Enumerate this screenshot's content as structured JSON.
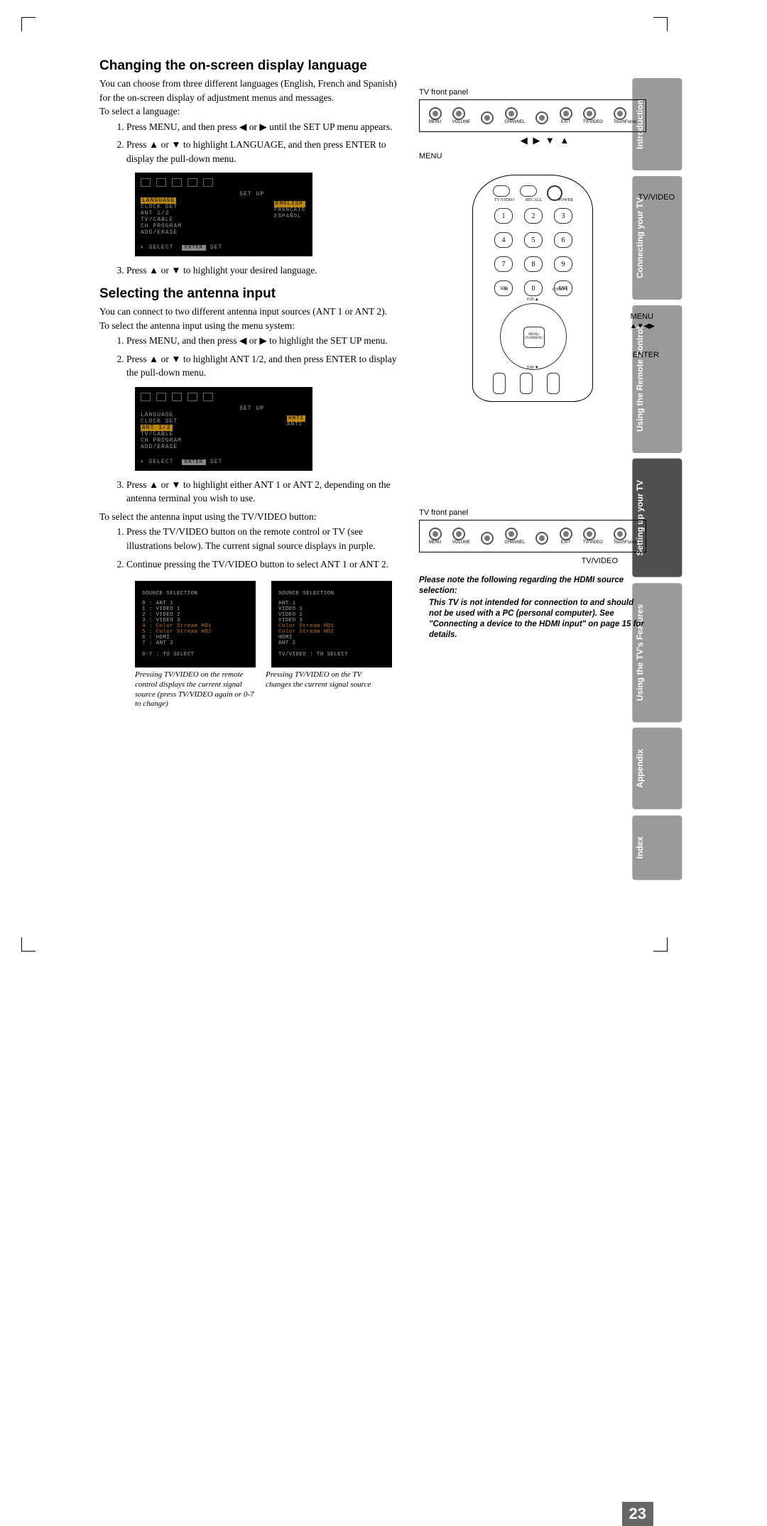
{
  "headings": {
    "h1a": "Changing the on-screen display language",
    "h1b": "Selecting the antenna input"
  },
  "body": {
    "p1": "You can choose from three different languages (English, French and Spanish) for the on-screen display of adjustment menus and messages.",
    "p2": "To select a language:",
    "li1": "Press MENU, and then press ◀ or ▶ until the SET UP menu appears.",
    "li2": "Press ▲ or ▼ to highlight LANGUAGE, and then press ENTER to display the pull-down menu.",
    "li3": "Press ▲ or ▼ to highlight your desired language.",
    "p3": "You can connect to two different antenna input sources (ANT 1 or ANT 2).",
    "p4": "To select the antenna input using the menu system:",
    "li4": "Press MENU, and then press ◀ or ▶ to highlight the SET UP menu.",
    "li5": "Press ▲ or ▼ to highlight ANT 1/2, and then press ENTER to display the pull-down menu.",
    "li6": "Press ▲ or ▼ to highlight either ANT 1 or ANT 2, depending on the antenna terminal you wish to use.",
    "p5": "To select the antenna input using the TV/VIDEO button:",
    "li7": "Press the TV/VIDEO button on the remote control or TV (see illustrations below). The current signal source displays in purple.",
    "li8": "Continue pressing the TV/VIDEO button to select ANT 1 or ANT 2."
  },
  "osd1": {
    "title": "SET UP",
    "items": [
      "LANGUAGE",
      "CLOCK SET",
      "ANT 1/2",
      "TV/CABLE",
      "CH PROGRAM",
      "ADD/ERASE"
    ],
    "opts": [
      "ENGLISH",
      "FRANÇAIS",
      "ESPAÑOL"
    ],
    "footer_select": "SELECT",
    "footer_enter": "ENTER",
    "footer_set": "SET"
  },
  "osd2": {
    "title": "SET UP",
    "items": [
      "LANGUAGE",
      "CLOCK SET",
      "ANT 1/2",
      "TV/CABLE",
      "CH PROGRAM",
      "ADD/ERASE"
    ],
    "opts": [
      "ANT1",
      "ANT2"
    ],
    "footer_select": "SELECT",
    "footer_enter": "ENTER",
    "footer_set": "SET"
  },
  "src1": {
    "title": "SOURCE SELECTION",
    "lines": [
      "0 : ANT 1",
      "1 : VIDEO 1",
      "2 : VIDEO 2",
      "3 : VIDEO 3",
      "4 : Color Stream HD1",
      "5 : Color Stream HD2",
      "6 : HDMI",
      "7 : ANT 2"
    ],
    "foot": "0-7 : TO SELECT"
  },
  "src2": {
    "title": "SOURCE SELECTION",
    "lines": [
      "ANT 1",
      "VIDEO 1",
      "VIDEO 2",
      "VIDEO 3",
      "Color Stream HD1",
      "Color Stream HD2",
      "HDMI",
      "ANT 2"
    ],
    "foot": "TV/VIDEO : TO SELECT"
  },
  "captions": {
    "c1": "Pressing TV/VIDEO on the remote control displays the current signal source (press TV/VIDEO again or 0-7 to change)",
    "c2": "Pressing TV/VIDEO on the TV changes the current signal source"
  },
  "right": {
    "fp_label": "TV front panel",
    "fp_buttons": [
      "MENU",
      "VOLUME",
      "",
      "CHANNEL",
      "",
      "EXIT",
      "TV/VIDEO",
      "TouchFocus"
    ],
    "menu": "MENU",
    "arrows": "◀ ▶ ▼ ▲",
    "remote_labels": {
      "tvvideo": "TV/VIDEO",
      "menu": "MENU",
      "menu_arrows": "▲▼◀▶",
      "enter": "ENTER"
    },
    "fp2_label": "TV front panel",
    "fp2_menu": "TV/VIDEO",
    "note1": "Please note the following regarding the HDMI source selection:",
    "note2": "This TV is not intended for connection to and should not be used with a PC (personal computer). See \"Connecting a device to the HDMI input\" on page 15 for details."
  },
  "tabs": [
    "Introduction",
    "Connecting your TV",
    "Using the Remote Control",
    "Setting up your TV",
    "Using the TV's Features",
    "Appendix",
    "Index"
  ],
  "page": "23"
}
